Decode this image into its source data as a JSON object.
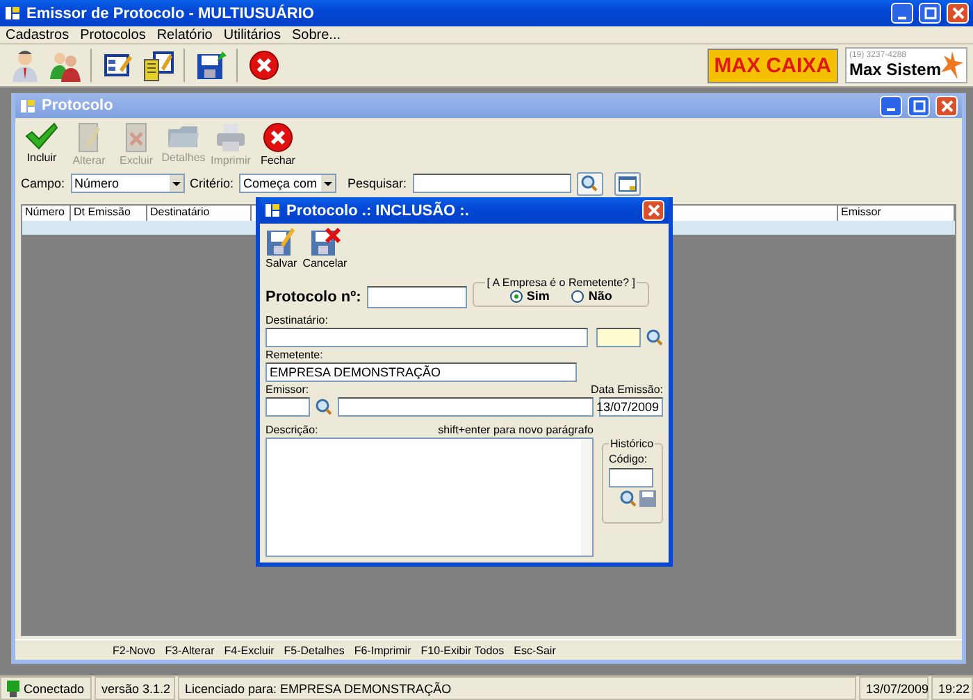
{
  "window": {
    "title": "Emissor de Protocolo - MULTIUSUÁRIO"
  },
  "menu": [
    "Cadastros",
    "Protocolos",
    "Relatório",
    "Utilitários",
    "Sobre..."
  ],
  "toolbar": [
    {
      "kind": "user"
    },
    {
      "kind": "users"
    },
    {
      "kind": "form"
    },
    {
      "kind": "forms"
    },
    {
      "kind": "save"
    },
    {
      "kind": "close"
    }
  ],
  "logos": {
    "max_caixa": "MAX CAIXA",
    "phone": "(19) 3237-4288",
    "max_sistem": "Max Sistem"
  },
  "child_window": {
    "title": "Protocolo",
    "buttons": [
      {
        "kind": "check",
        "label": "Incluir",
        "disabled": false
      },
      {
        "kind": "edit",
        "label": "Alterar",
        "disabled": true
      },
      {
        "kind": "delete",
        "label": "Excluir",
        "disabled": true
      },
      {
        "kind": "folder",
        "label": "Detalhes",
        "disabled": true
      },
      {
        "kind": "print",
        "label": "Imprimir",
        "disabled": true
      },
      {
        "kind": "close",
        "label": "Fechar",
        "disabled": false
      }
    ],
    "filter": {
      "campo_label": "Campo:",
      "campo_value": "Número",
      "criterio_label": "Critério:",
      "criterio_value": "Começa com",
      "pesquisar_label": "Pesquisar:"
    },
    "columns": [
      {
        "label": "Número"
      },
      {
        "label": "Dt Emissão"
      },
      {
        "label": "Destinatário"
      },
      {
        "label": "Emissor"
      }
    ],
    "shortcuts": [
      "F2-Novo",
      "F3-Alterar",
      "F4-Excluir",
      "F5-Detalhes",
      "F6-Imprimir",
      "F10-Exibir Todos",
      "Esc-Sair"
    ]
  },
  "dialog": {
    "title": "Protocolo  .: INCLUSÃO :.",
    "buttons": [
      {
        "kind": "save",
        "label": "Salvar"
      },
      {
        "kind": "cancel",
        "label": "Cancelar"
      }
    ],
    "protocolo_label": "Protocolo nº:",
    "empresa_group": {
      "legend": "[ A Empresa é o Remetente? ]",
      "options": [
        {
          "label": "Sim",
          "selected": true
        },
        {
          "label": "Não",
          "selected": false
        }
      ]
    },
    "destinatario_label": "Destinatário:",
    "remetente_label": "Remetente:",
    "remetente_value": "EMPRESA DEMONSTRAÇÃO",
    "emissor_label": "Emissor:",
    "data_label": "Data Emissão:",
    "data_value": "13/07/2009",
    "descricao_label": "Descrição:",
    "descricao_hint": "shift+enter para novo parágrafo",
    "historico": {
      "legend": "Histórico",
      "codigo_label": "Código:"
    }
  },
  "status_bar": [
    {
      "kind": "connection",
      "text": "Conectado"
    },
    {
      "kind": "text",
      "text": "versão 3.1.2"
    },
    {
      "kind": "wide",
      "text": "Licenciado para: EMPRESA DEMONSTRAÇÃO"
    },
    {
      "kind": "text",
      "text": "13/07/2009"
    },
    {
      "kind": "text",
      "text": "19:22"
    }
  ]
}
